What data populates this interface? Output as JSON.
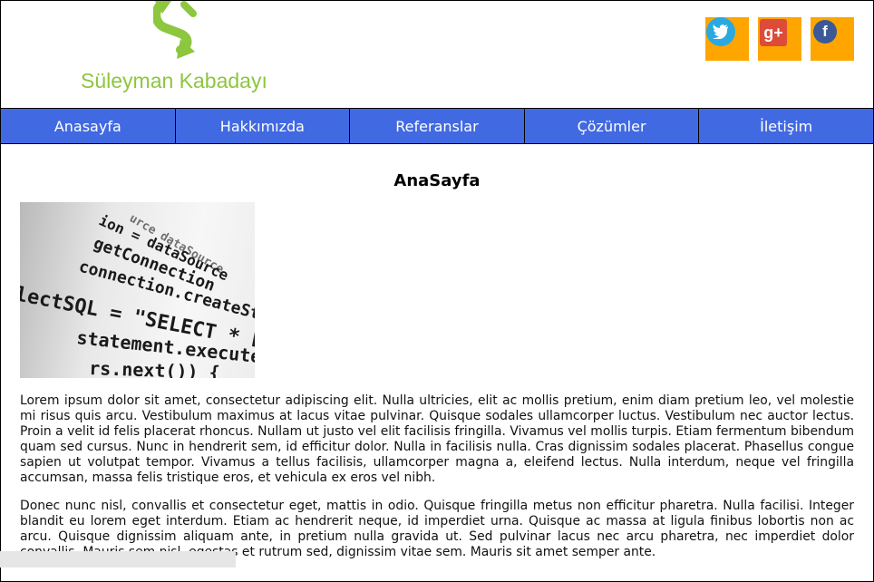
{
  "header": {
    "site_title": "Süleyman Kabadayı",
    "logo_color": "#8dc63f"
  },
  "social": [
    {
      "name": "twitter",
      "glyph": "🐦",
      "bg": "#ffa500",
      "circle": "#2aa9e0"
    },
    {
      "name": "google-plus",
      "glyph": "g+",
      "bg": "#ffa500",
      "circle": "#dd4b39"
    },
    {
      "name": "facebook",
      "glyph": "f",
      "bg": "#ffa500",
      "circle": "#3b5998"
    }
  ],
  "nav": {
    "color": "#4169e1",
    "items": [
      "Anasayfa",
      "Hakkımızda",
      "Referanslar",
      "Çözümler",
      "İletişim"
    ]
  },
  "main": {
    "title": "AnaSayfa",
    "image_text_lines": [
      "urce dataSource",
      "ion = dataSource",
      "getConnection",
      "connection.createStatement",
      "lectSQL = \"SELECT * FROM",
      "statement.execute",
      "rs.next()) {"
    ],
    "paragraphs": [
      "Lorem ipsum dolor sit amet, consectetur adipiscing elit. Nulla ultricies, elit ac mollis pretium, enim diam pretium leo, vel molestie mi risus quis arcu. Vestibulum maximus at lacus vitae pulvinar. Quisque sodales ullamcorper luctus. Vestibulum nec auctor lectus. Proin a velit id felis placerat rhoncus. Nullam ut justo vel elit facilisis fringilla. Vivamus vel mollis turpis. Etiam fermentum bibendum quam sed cursus. Nunc in hendrerit sem, id efficitur dolor. Nulla in facilisis nulla. Cras dignissim sodales placerat. Phasellus congue sapien ut volutpat tempor. Vivamus a tellus facilisis, ullamcorper magna a, eleifend lectus. Nulla interdum, neque vel fringilla accumsan, massa felis tristique eros, et vehicula ex eros vel nibh.",
      "Donec nunc nisl, convallis et consectetur eget, mattis in odio. Quisque fringilla metus non efficitur pharetra. Nulla facilisi. Integer blandit eu lorem eget interdum. Etiam ac hendrerit neque, id imperdiet urna. Quisque ac massa at ligula finibus lobortis non ac arcu. Quisque dignissim aliquam ante, in pretium nulla gravida ut. Sed pulvinar lacus nec arcu pharetra, nec imperdiet dolor convallis. Mauris sem nisl, egestas et rutrum sed, dignissim vitae sem. Mauris sit amet semper ante."
    ]
  }
}
